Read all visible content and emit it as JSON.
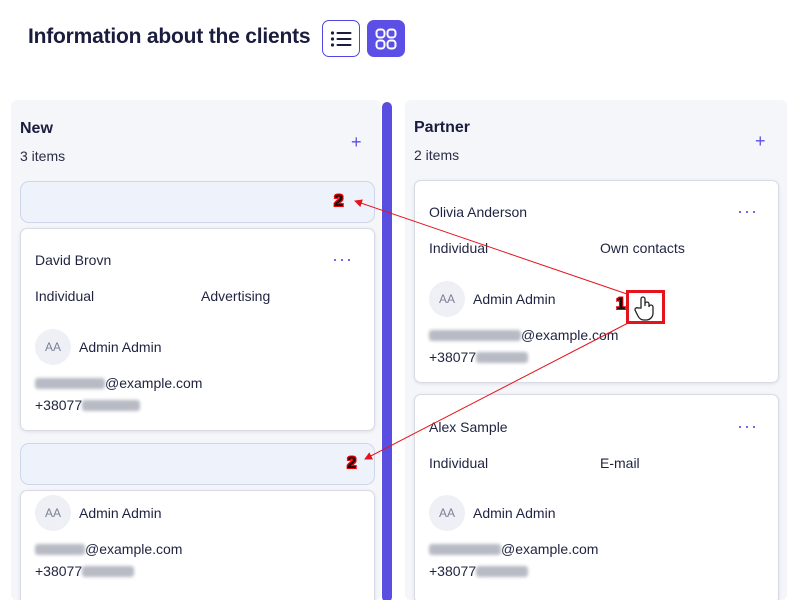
{
  "page": {
    "title": "Information about the clients"
  },
  "view_toggle": {
    "list_icon": "list-icon",
    "grid_icon": "grid-icon",
    "accent": "#5b4fe6"
  },
  "columns": [
    {
      "title": "New",
      "count": "3 items",
      "add_label": "+",
      "cards": [
        {
          "name": "David Brovn",
          "more": "···",
          "type": "Individual",
          "source": "Advertising",
          "avatar": "AA",
          "owner": "Admin Admin",
          "email_domain": "@example.com",
          "phone_prefix": "+38077"
        },
        {
          "name": "",
          "more": "",
          "type": "",
          "source": "",
          "avatar": "AA",
          "owner": "Admin Admin",
          "email_domain": "@example.com",
          "phone_prefix": "+38077"
        }
      ]
    },
    {
      "title": "Partner",
      "count": "2 items",
      "add_label": "+",
      "cards": [
        {
          "name": "Olivia Anderson",
          "more": "···",
          "type": "Individual",
          "source": "Own contacts",
          "avatar": "AA",
          "owner": "Admin Admin",
          "email_domain": "@example.com",
          "phone_prefix": "+38077"
        },
        {
          "name": "Alex Sample",
          "more": "···",
          "type": "Individual",
          "source": "E-mail",
          "avatar": "AA",
          "owner": "Admin Admin",
          "email_domain": "@example.com",
          "phone_prefix": "+38077"
        }
      ]
    }
  ],
  "annotations": {
    "step1": "1",
    "step2": "2",
    "color": "#e5131b"
  }
}
